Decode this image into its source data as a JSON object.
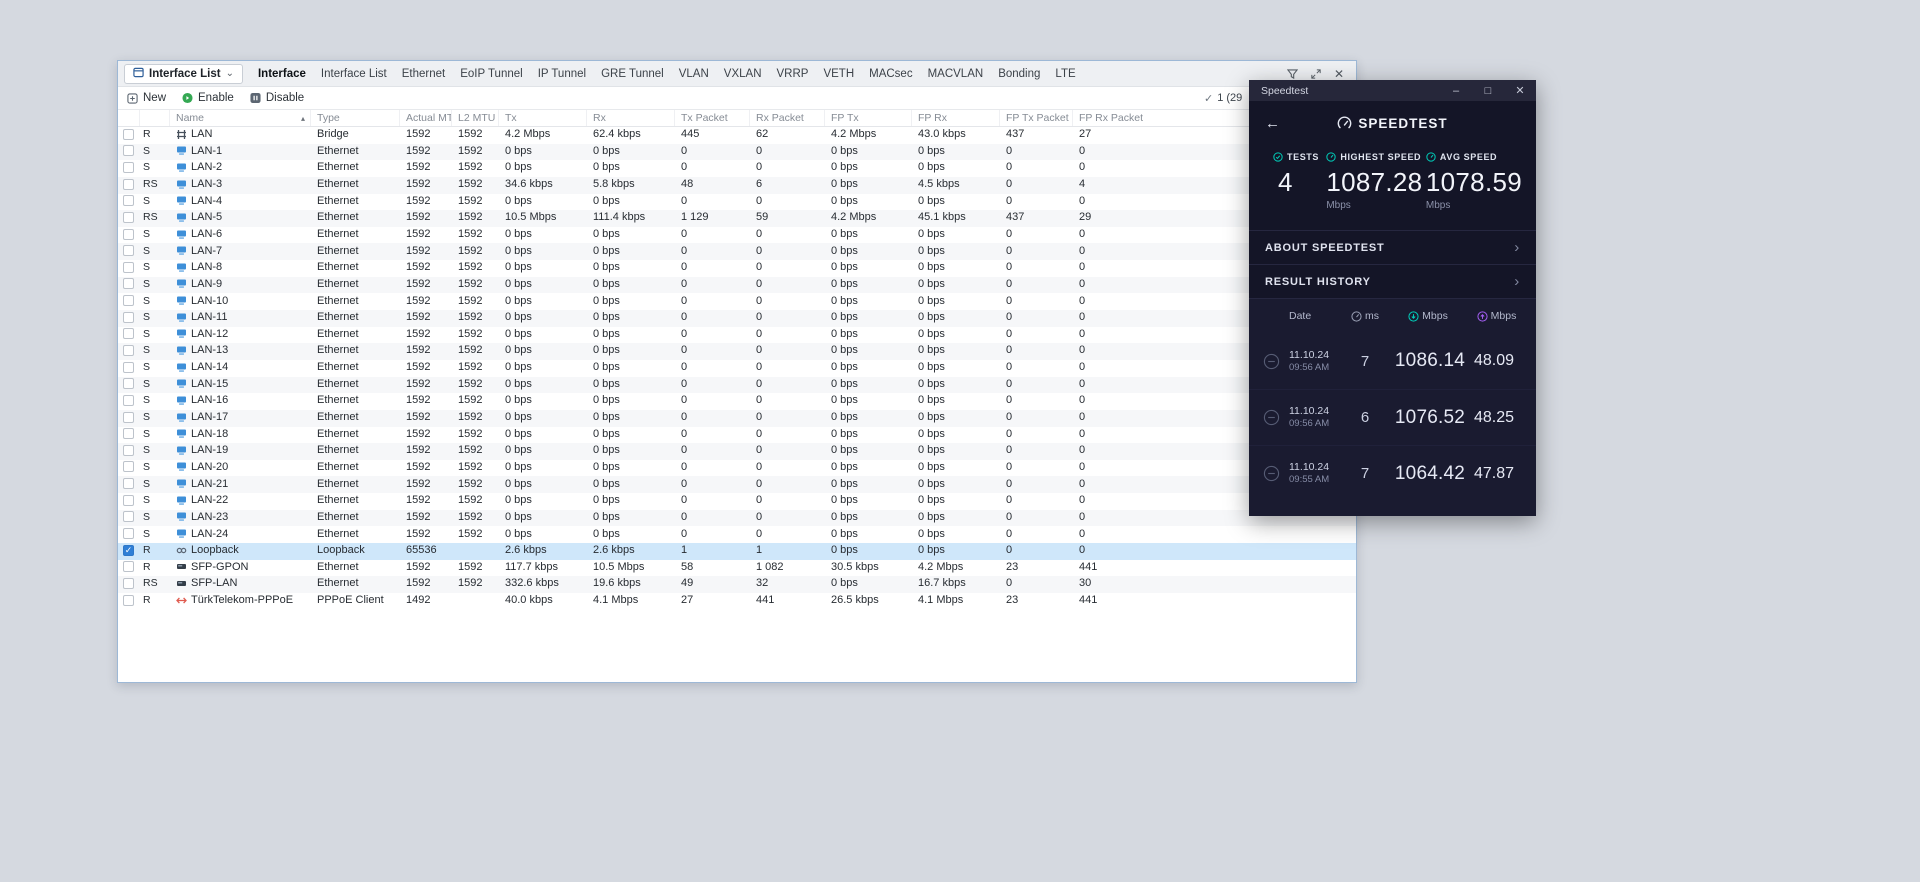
{
  "glyphs": {
    "caret_down": "⌄",
    "sort_asc": "▴",
    "check": "✓",
    "chevron_right": "›",
    "back_arrow": "←",
    "minimize": "–",
    "maximize": "□",
    "close": "✕"
  },
  "main_window": {
    "selector_label": "Interface List",
    "tabs": [
      {
        "label": "Interface",
        "active": true
      },
      {
        "label": "Interface List"
      },
      {
        "label": "Ethernet"
      },
      {
        "label": "EoIP Tunnel"
      },
      {
        "label": "IP Tunnel"
      },
      {
        "label": "GRE Tunnel"
      },
      {
        "label": "VLAN"
      },
      {
        "label": "VXLAN"
      },
      {
        "label": "VRRP"
      },
      {
        "label": "VETH"
      },
      {
        "label": "MACsec"
      },
      {
        "label": "MACVLAN"
      },
      {
        "label": "Bonding"
      },
      {
        "label": "LTE"
      }
    ],
    "toolbar": {
      "new_label": "New",
      "enable_label": "Enable",
      "disable_label": "Disable",
      "selection_count": "1 (29"
    },
    "table": {
      "headers": [
        "Name",
        "Type",
        "Actual MTU",
        "L2 MTU",
        "Tx",
        "Rx",
        "Tx Packet",
        "Rx Packet",
        "FP Tx",
        "FP Rx",
        "FP Tx Packet",
        "FP Rx Packet"
      ],
      "rows": [
        {
          "f": "R",
          "icon": "bridge-icon",
          "name": "LAN",
          "type": "Bridge",
          "amtu": "1592",
          "l2": "1592",
          "tx": "4.2 Mbps",
          "rx": "62.4 kbps",
          "txp": "445",
          "rxp": "62",
          "fptx": "4.2 Mbps",
          "fprx": "43.0 kbps",
          "fptxp": "437",
          "fprxp": "27"
        },
        {
          "f": "S",
          "icon": "ethernet-icon",
          "name": "LAN-1",
          "type": "Ethernet",
          "amtu": "1592",
          "l2": "1592",
          "tx": "0 bps",
          "rx": "0 bps",
          "txp": "0",
          "rxp": "0",
          "fptx": "0 bps",
          "fprx": "0 bps",
          "fptxp": "0",
          "fprxp": "0"
        },
        {
          "f": "S",
          "icon": "ethernet-icon",
          "name": "LAN-2",
          "type": "Ethernet",
          "amtu": "1592",
          "l2": "1592",
          "tx": "0 bps",
          "rx": "0 bps",
          "txp": "0",
          "rxp": "0",
          "fptx": "0 bps",
          "fprx": "0 bps",
          "fptxp": "0",
          "fprxp": "0"
        },
        {
          "f": "RS",
          "icon": "ethernet-icon",
          "name": "LAN-3",
          "type": "Ethernet",
          "amtu": "1592",
          "l2": "1592",
          "tx": "34.6 kbps",
          "rx": "5.8 kbps",
          "txp": "48",
          "rxp": "6",
          "fptx": "0 bps",
          "fprx": "4.5 kbps",
          "fptxp": "0",
          "fprxp": "4"
        },
        {
          "f": "S",
          "icon": "ethernet-icon",
          "name": "LAN-4",
          "type": "Ethernet",
          "amtu": "1592",
          "l2": "1592",
          "tx": "0 bps",
          "rx": "0 bps",
          "txp": "0",
          "rxp": "0",
          "fptx": "0 bps",
          "fprx": "0 bps",
          "fptxp": "0",
          "fprxp": "0"
        },
        {
          "f": "RS",
          "icon": "ethernet-icon",
          "name": "LAN-5",
          "type": "Ethernet",
          "amtu": "1592",
          "l2": "1592",
          "tx": "10.5 Mbps",
          "rx": "111.4 kbps",
          "txp": "1 129",
          "rxp": "59",
          "fptx": "4.2 Mbps",
          "fprx": "45.1 kbps",
          "fptxp": "437",
          "fprxp": "29"
        },
        {
          "f": "S",
          "icon": "ethernet-icon",
          "name": "LAN-6",
          "type": "Ethernet",
          "amtu": "1592",
          "l2": "1592",
          "tx": "0 bps",
          "rx": "0 bps",
          "txp": "0",
          "rxp": "0",
          "fptx": "0 bps",
          "fprx": "0 bps",
          "fptxp": "0",
          "fprxp": "0"
        },
        {
          "f": "S",
          "icon": "ethernet-icon",
          "name": "LAN-7",
          "type": "Ethernet",
          "amtu": "1592",
          "l2": "1592",
          "tx": "0 bps",
          "rx": "0 bps",
          "txp": "0",
          "rxp": "0",
          "fptx": "0 bps",
          "fprx": "0 bps",
          "fptxp": "0",
          "fprxp": "0"
        },
        {
          "f": "S",
          "icon": "ethernet-icon",
          "name": "LAN-8",
          "type": "Ethernet",
          "amtu": "1592",
          "l2": "1592",
          "tx": "0 bps",
          "rx": "0 bps",
          "txp": "0",
          "rxp": "0",
          "fptx": "0 bps",
          "fprx": "0 bps",
          "fptxp": "0",
          "fprxp": "0"
        },
        {
          "f": "S",
          "icon": "ethernet-icon",
          "name": "LAN-9",
          "type": "Ethernet",
          "amtu": "1592",
          "l2": "1592",
          "tx": "0 bps",
          "rx": "0 bps",
          "txp": "0",
          "rxp": "0",
          "fptx": "0 bps",
          "fprx": "0 bps",
          "fptxp": "0",
          "fprxp": "0"
        },
        {
          "f": "S",
          "icon": "ethernet-icon",
          "name": "LAN-10",
          "type": "Ethernet",
          "amtu": "1592",
          "l2": "1592",
          "tx": "0 bps",
          "rx": "0 bps",
          "txp": "0",
          "rxp": "0",
          "fptx": "0 bps",
          "fprx": "0 bps",
          "fptxp": "0",
          "fprxp": "0"
        },
        {
          "f": "S",
          "icon": "ethernet-icon",
          "name": "LAN-11",
          "type": "Ethernet",
          "amtu": "1592",
          "l2": "1592",
          "tx": "0 bps",
          "rx": "0 bps",
          "txp": "0",
          "rxp": "0",
          "fptx": "0 bps",
          "fprx": "0 bps",
          "fptxp": "0",
          "fprxp": "0"
        },
        {
          "f": "S",
          "icon": "ethernet-icon",
          "name": "LAN-12",
          "type": "Ethernet",
          "amtu": "1592",
          "l2": "1592",
          "tx": "0 bps",
          "rx": "0 bps",
          "txp": "0",
          "rxp": "0",
          "fptx": "0 bps",
          "fprx": "0 bps",
          "fptxp": "0",
          "fprxp": "0"
        },
        {
          "f": "S",
          "icon": "ethernet-icon",
          "name": "LAN-13",
          "type": "Ethernet",
          "amtu": "1592",
          "l2": "1592",
          "tx": "0 bps",
          "rx": "0 bps",
          "txp": "0",
          "rxp": "0",
          "fptx": "0 bps",
          "fprx": "0 bps",
          "fptxp": "0",
          "fprxp": "0"
        },
        {
          "f": "S",
          "icon": "ethernet-icon",
          "name": "LAN-14",
          "type": "Ethernet",
          "amtu": "1592",
          "l2": "1592",
          "tx": "0 bps",
          "rx": "0 bps",
          "txp": "0",
          "rxp": "0",
          "fptx": "0 bps",
          "fprx": "0 bps",
          "fptxp": "0",
          "fprxp": "0"
        },
        {
          "f": "S",
          "icon": "ethernet-icon",
          "name": "LAN-15",
          "type": "Ethernet",
          "amtu": "1592",
          "l2": "1592",
          "tx": "0 bps",
          "rx": "0 bps",
          "txp": "0",
          "rxp": "0",
          "fptx": "0 bps",
          "fprx": "0 bps",
          "fptxp": "0",
          "fprxp": "0"
        },
        {
          "f": "S",
          "icon": "ethernet-icon",
          "name": "LAN-16",
          "type": "Ethernet",
          "amtu": "1592",
          "l2": "1592",
          "tx": "0 bps",
          "rx": "0 bps",
          "txp": "0",
          "rxp": "0",
          "fptx": "0 bps",
          "fprx": "0 bps",
          "fptxp": "0",
          "fprxp": "0"
        },
        {
          "f": "S",
          "icon": "ethernet-icon",
          "name": "LAN-17",
          "type": "Ethernet",
          "amtu": "1592",
          "l2": "1592",
          "tx": "0 bps",
          "rx": "0 bps",
          "txp": "0",
          "rxp": "0",
          "fptx": "0 bps",
          "fprx": "0 bps",
          "fptxp": "0",
          "fprxp": "0"
        },
        {
          "f": "S",
          "icon": "ethernet-icon",
          "name": "LAN-18",
          "type": "Ethernet",
          "amtu": "1592",
          "l2": "1592",
          "tx": "0 bps",
          "rx": "0 bps",
          "txp": "0",
          "rxp": "0",
          "fptx": "0 bps",
          "fprx": "0 bps",
          "fptxp": "0",
          "fprxp": "0"
        },
        {
          "f": "S",
          "icon": "ethernet-icon",
          "name": "LAN-19",
          "type": "Ethernet",
          "amtu": "1592",
          "l2": "1592",
          "tx": "0 bps",
          "rx": "0 bps",
          "txp": "0",
          "rxp": "0",
          "fptx": "0 bps",
          "fprx": "0 bps",
          "fptxp": "0",
          "fprxp": "0"
        },
        {
          "f": "S",
          "icon": "ethernet-icon",
          "name": "LAN-20",
          "type": "Ethernet",
          "amtu": "1592",
          "l2": "1592",
          "tx": "0 bps",
          "rx": "0 bps",
          "txp": "0",
          "rxp": "0",
          "fptx": "0 bps",
          "fprx": "0 bps",
          "fptxp": "0",
          "fprxp": "0"
        },
        {
          "f": "S",
          "icon": "ethernet-icon",
          "name": "LAN-21",
          "type": "Ethernet",
          "amtu": "1592",
          "l2": "1592",
          "tx": "0 bps",
          "rx": "0 bps",
          "txp": "0",
          "rxp": "0",
          "fptx": "0 bps",
          "fprx": "0 bps",
          "fptxp": "0",
          "fprxp": "0"
        },
        {
          "f": "S",
          "icon": "ethernet-icon",
          "name": "LAN-22",
          "type": "Ethernet",
          "amtu": "1592",
          "l2": "1592",
          "tx": "0 bps",
          "rx": "0 bps",
          "txp": "0",
          "rxp": "0",
          "fptx": "0 bps",
          "fprx": "0 bps",
          "fptxp": "0",
          "fprxp": "0"
        },
        {
          "f": "S",
          "icon": "ethernet-icon",
          "name": "LAN-23",
          "type": "Ethernet",
          "amtu": "1592",
          "l2": "1592",
          "tx": "0 bps",
          "rx": "0 bps",
          "txp": "0",
          "rxp": "0",
          "fptx": "0 bps",
          "fprx": "0 bps",
          "fptxp": "0",
          "fprxp": "0"
        },
        {
          "f": "S",
          "icon": "ethernet-icon",
          "name": "LAN-24",
          "type": "Ethernet",
          "amtu": "1592",
          "l2": "1592",
          "tx": "0 bps",
          "rx": "0 bps",
          "txp": "0",
          "rxp": "0",
          "fptx": "0 bps",
          "fprx": "0 bps",
          "fptxp": "0",
          "fprxp": "0"
        },
        {
          "f": "R",
          "icon": "loopback-icon",
          "name": "Loopback",
          "type": "Loopback",
          "amtu": "65536",
          "l2": "",
          "tx": "2.6 kbps",
          "rx": "2.6 kbps",
          "txp": "1",
          "rxp": "1",
          "fptx": "0 bps",
          "fprx": "0 bps",
          "fptxp": "0",
          "fprxp": "0",
          "sel": true,
          "chk": true
        },
        {
          "f": "R",
          "icon": "sfp-icon",
          "name": "SFP-GPON",
          "type": "Ethernet",
          "amtu": "1592",
          "l2": "1592",
          "tx": "117.7 kbps",
          "rx": "10.5 Mbps",
          "txp": "58",
          "rxp": "1 082",
          "fptx": "30.5 kbps",
          "fprx": "4.2 Mbps",
          "fptxp": "23",
          "fprxp": "441"
        },
        {
          "f": "RS",
          "icon": "sfp-icon",
          "name": "SFP-LAN",
          "type": "Ethernet",
          "amtu": "1592",
          "l2": "1592",
          "tx": "332.6 kbps",
          "rx": "19.6 kbps",
          "txp": "49",
          "rxp": "32",
          "fptx": "0 bps",
          "fprx": "16.7 kbps",
          "fptxp": "0",
          "fprxp": "30"
        },
        {
          "f": "R",
          "icon": "pppoe-icon",
          "name": "TürkTelekom-PPPoE",
          "type": "PPPoE Client",
          "amtu": "1492",
          "l2": "",
          "tx": "40.0 kbps",
          "rx": "4.1 Mbps",
          "txp": "27",
          "rxp": "441",
          "fptx": "26.5 kbps",
          "fprx": "4.1 Mbps",
          "fptxp": "23",
          "fprxp": "441"
        }
      ]
    }
  },
  "speedtest": {
    "title": "Speedtest",
    "logo_text": "SPEEDTEST",
    "stats": [
      {
        "label": "TESTS",
        "value": "4",
        "unit": ""
      },
      {
        "label": "HIGHEST SPEED",
        "value": "1087.28",
        "unit": "Mbps"
      },
      {
        "label": "AVG SPEED",
        "value": "1078.59",
        "unit": "Mbps"
      }
    ],
    "menu": [
      {
        "label": "ABOUT SPEEDTEST"
      },
      {
        "label": "RESULT HISTORY"
      }
    ],
    "history_header": {
      "date": "Date",
      "ping_unit": "ms",
      "down_unit": "Mbps",
      "up_unit": "Mbps"
    },
    "history": [
      {
        "date": "11.10.24",
        "time": "09:56 AM",
        "ping": "7",
        "down": "1086.14",
        "up": "48.09"
      },
      {
        "date": "11.10.24",
        "time": "09:56 AM",
        "ping": "6",
        "down": "1076.52",
        "up": "48.25"
      },
      {
        "date": "11.10.24",
        "time": "09:55 AM",
        "ping": "7",
        "down": "1064.42",
        "up": "47.87"
      }
    ]
  }
}
